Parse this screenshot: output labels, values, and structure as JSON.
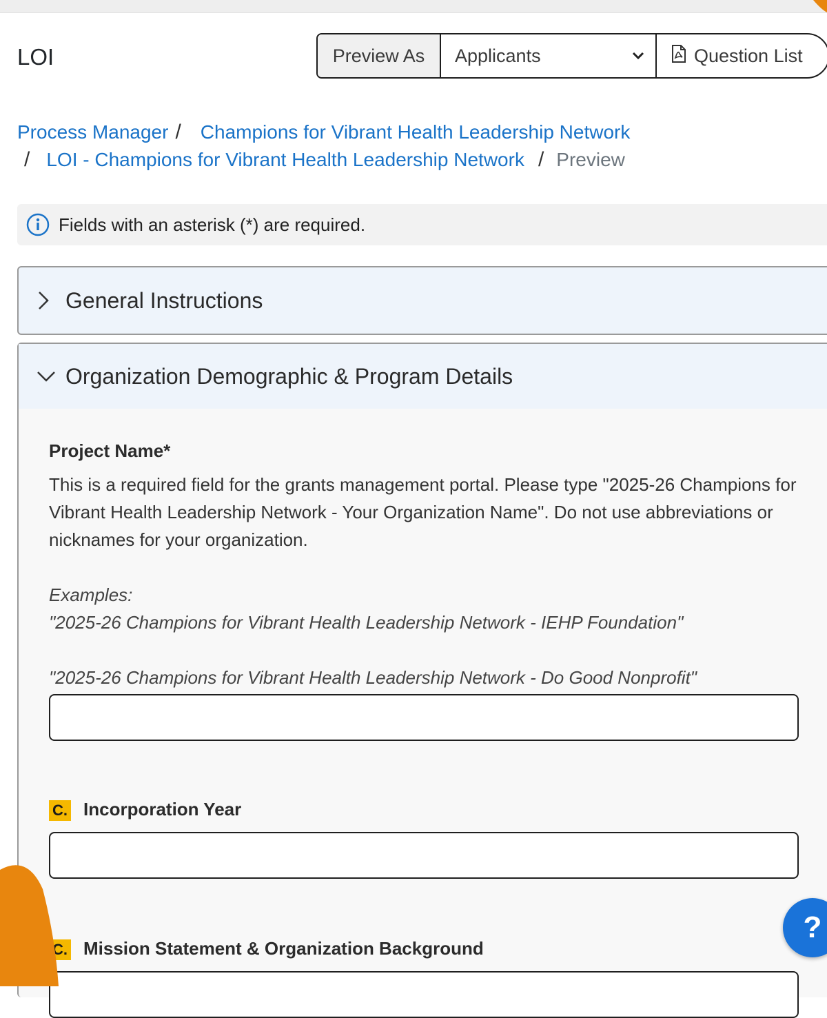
{
  "header": {
    "title": "LOI"
  },
  "toolbar": {
    "preview_as_label": "Preview As",
    "audience_value": "Applicants",
    "question_list_label": "Question List"
  },
  "breadcrumb": {
    "items": [
      "Process Manager",
      "Champions for Vibrant Health Leadership Network",
      "LOI - Champions for Vibrant Health Leadership Network"
    ],
    "current": "Preview",
    "separator": "/"
  },
  "notice": {
    "text": "Fields with an asterisk (*) are required."
  },
  "sections": [
    {
      "title": "General Instructions",
      "expanded": false
    },
    {
      "title": "Organization Demographic & Program Details",
      "expanded": true
    }
  ],
  "form": {
    "project_name": {
      "label": "Project Name*",
      "description": "This is a required field for the grants management portal. Please type \"2025-26 Champions for Vibrant Health Leadership Network - Your Organization Name\". Do not use abbreviations or nicknames for your organization.",
      "examples_heading": "Examples:",
      "example_1": "\"2025-26 Champions for Vibrant Health Leadership Network - IEHP Foundation\"",
      "example_2": "\"2025-26 Champions for Vibrant Health Leadership Network - Do Good Nonprofit\"",
      "value": ""
    },
    "incorporation_year": {
      "badge": "C.",
      "label": "Incorporation Year",
      "value": ""
    },
    "mission": {
      "badge": "C.",
      "label": "Mission Statement & Organization Background"
    }
  },
  "help": {
    "label": "?"
  },
  "colors": {
    "link": "#1a73c8",
    "accent_badge": "#f5b800",
    "help_button": "#1a73d9",
    "decoration": "#e8860e"
  }
}
